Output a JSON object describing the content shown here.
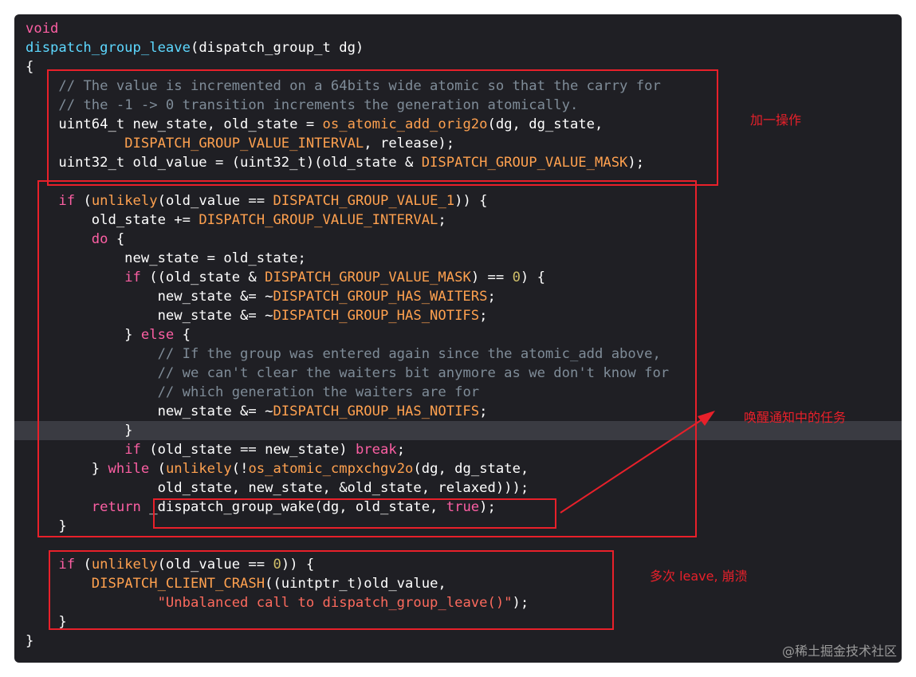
{
  "code": [
    [
      [
        "kw",
        "void"
      ]
    ],
    [
      [
        "def",
        "dispatch_group_leave"
      ],
      [
        "pl",
        "(dispatch_group_t dg)"
      ]
    ],
    [
      [
        "pl",
        "{"
      ]
    ],
    [
      [
        "pl",
        "    "
      ],
      [
        "cm",
        "// The value is incremented on a 64bits wide atomic so that the carry for"
      ]
    ],
    [
      [
        "pl",
        "    "
      ],
      [
        "cm",
        "// the -1 -> 0 transition increments the generation atomically."
      ]
    ],
    [
      [
        "pl",
        "    uint64_t new_state, old_state = "
      ],
      [
        "fn",
        "os_atomic_add_orig2o"
      ],
      [
        "pl",
        "(dg, dg_state,"
      ]
    ],
    [
      [
        "pl",
        "            "
      ],
      [
        "fn",
        "DISPATCH_GROUP_VALUE_INTERVAL"
      ],
      [
        "pl",
        ", release);"
      ]
    ],
    [
      [
        "pl",
        "    uint32_t old_value = (uint32_t)(old_state & "
      ],
      [
        "fn",
        "DISPATCH_GROUP_VALUE_MASK"
      ],
      [
        "pl",
        ");"
      ]
    ],
    [],
    [
      [
        "pl",
        "    "
      ],
      [
        "kw",
        "if"
      ],
      [
        "pl",
        " ("
      ],
      [
        "fn",
        "unlikely"
      ],
      [
        "pl",
        "(old_value == "
      ],
      [
        "fn",
        "DISPATCH_GROUP_VALUE_1"
      ],
      [
        "pl",
        ")) {"
      ]
    ],
    [
      [
        "pl",
        "        old_state += "
      ],
      [
        "fn",
        "DISPATCH_GROUP_VALUE_INTERVAL"
      ],
      [
        "pl",
        ";"
      ]
    ],
    [
      [
        "pl",
        "        "
      ],
      [
        "kw",
        "do"
      ],
      [
        "pl",
        " {"
      ]
    ],
    [
      [
        "pl",
        "            new_state = old_state;"
      ]
    ],
    [
      [
        "pl",
        "            "
      ],
      [
        "kw",
        "if"
      ],
      [
        "pl",
        " ((old_state & "
      ],
      [
        "fn",
        "DISPATCH_GROUP_VALUE_MASK"
      ],
      [
        "pl",
        ") == "
      ],
      [
        "num",
        "0"
      ],
      [
        "pl",
        ") {"
      ]
    ],
    [
      [
        "pl",
        "                new_state &= ~"
      ],
      [
        "fn",
        "DISPATCH_GROUP_HAS_WAITERS"
      ],
      [
        "pl",
        ";"
      ]
    ],
    [
      [
        "pl",
        "                new_state &= ~"
      ],
      [
        "fn",
        "DISPATCH_GROUP_HAS_NOTIFS"
      ],
      [
        "pl",
        ";"
      ]
    ],
    [
      [
        "pl",
        "            } "
      ],
      [
        "kw",
        "else"
      ],
      [
        "pl",
        " {"
      ]
    ],
    [
      [
        "pl",
        "                "
      ],
      [
        "cm",
        "// If the group was entered again since the atomic_add above,"
      ]
    ],
    [
      [
        "pl",
        "                "
      ],
      [
        "cm",
        "// we can't clear the waiters bit anymore as we don't know for"
      ]
    ],
    [
      [
        "pl",
        "                "
      ],
      [
        "cm",
        "// which generation the waiters are for"
      ]
    ],
    [
      [
        "pl",
        "                new_state &= ~"
      ],
      [
        "fn",
        "DISPATCH_GROUP_HAS_NOTIFS"
      ],
      [
        "pl",
        ";"
      ]
    ],
    [
      [
        "pl",
        "            }"
      ]
    ],
    [
      [
        "pl",
        "            "
      ],
      [
        "kw",
        "if"
      ],
      [
        "pl",
        " (old_state == new_state) "
      ],
      [
        "kw",
        "break"
      ],
      [
        "pl",
        ";"
      ]
    ],
    [
      [
        "pl",
        "        } "
      ],
      [
        "kw",
        "while"
      ],
      [
        "pl",
        " ("
      ],
      [
        "fn",
        "unlikely"
      ],
      [
        "pl",
        "(!"
      ],
      [
        "fn",
        "os_atomic_cmpxchgv2o"
      ],
      [
        "pl",
        "(dg, dg_state,"
      ]
    ],
    [
      [
        "pl",
        "                old_state, new_state, &old_state, relaxed)));"
      ]
    ],
    [
      [
        "pl",
        "        "
      ],
      [
        "kw",
        "return"
      ],
      [
        "pl",
        " _dispatch_group_wake(dg, old_state, "
      ],
      [
        "kw",
        "true"
      ],
      [
        "pl",
        ");"
      ]
    ],
    [
      [
        "pl",
        "    }"
      ]
    ],
    [],
    [
      [
        "pl",
        "    "
      ],
      [
        "kw",
        "if"
      ],
      [
        "pl",
        " ("
      ],
      [
        "fn",
        "unlikely"
      ],
      [
        "pl",
        "(old_value == "
      ],
      [
        "num",
        "0"
      ],
      [
        "pl",
        ")) {"
      ]
    ],
    [
      [
        "pl",
        "        "
      ],
      [
        "fn",
        "DISPATCH_CLIENT_CRASH"
      ],
      [
        "pl",
        "((uintptr_t)old_value,"
      ]
    ],
    [
      [
        "pl",
        "                "
      ],
      [
        "str",
        "\"Unbalanced call to dispatch_group_leave()\""
      ],
      [
        "pl",
        ");"
      ]
    ],
    [
      [
        "pl",
        "    }"
      ]
    ],
    [
      [
        "pl",
        "}"
      ]
    ]
  ],
  "annotations": {
    "increment": "加一操作",
    "wake": "唤醒通知中的任务",
    "crash": "多次 leave, 崩溃"
  },
  "watermark": "@稀土掘金技术社区",
  "colors": {
    "background": "#1f1f24",
    "highlight_line": "#3a3b42",
    "keyword": "#fc5fa3",
    "function": "#ffa14f",
    "declaration": "#5dd8ff",
    "comment": "#7f8c98",
    "number": "#d0bf69",
    "string": "#fc6a5d",
    "annotation_red": "#e8202a"
  }
}
